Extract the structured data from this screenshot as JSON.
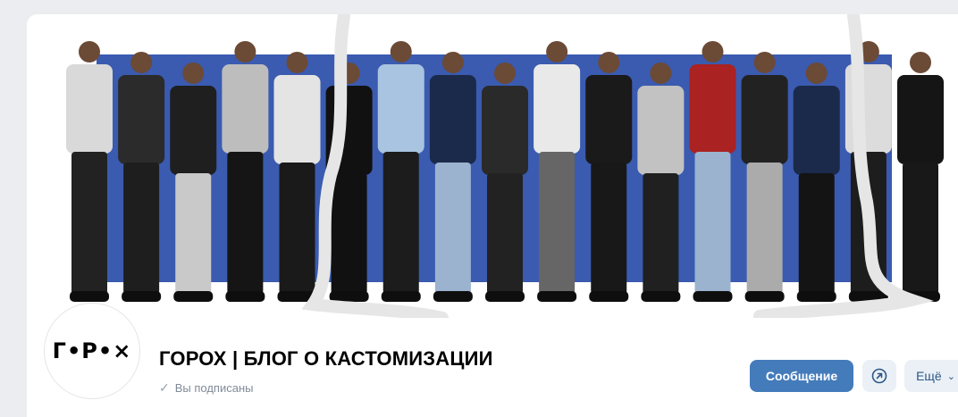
{
  "community": {
    "logo_text": "Г•P•×",
    "title": "ГОРОХ | БЛОГ О КАСТОМИЗАЦИИ",
    "subscribed_label": "Вы подписаны"
  },
  "actions": {
    "message_label": "Сообщение",
    "share_icon": "arrow-up-right-circle-icon",
    "more_label": "Ещё"
  },
  "cover": {
    "backdrop_color": "#3a5bb0",
    "figure_count": 17
  },
  "colors": {
    "accent": "#447bba",
    "secondary_button_bg": "#ebf0f6",
    "secondary_text": "#818c99"
  }
}
